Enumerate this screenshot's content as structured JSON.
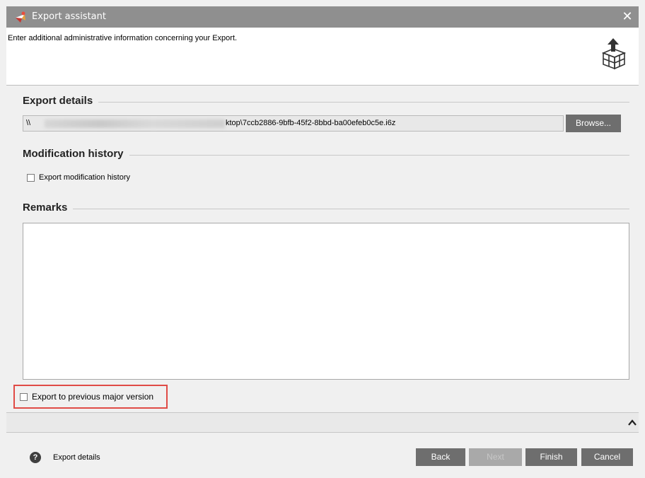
{
  "window": {
    "title": "Export assistant",
    "close_symbol": "✕"
  },
  "header": {
    "instruction": "Enter additional administrative information concerning your Export."
  },
  "export_details": {
    "title": "Export details",
    "path_prefix": "\\\\",
    "path_visible": "ktop\\7ccb2886-9bfb-45f2-8bbd-ba00efeb0c5e.i6z",
    "browse_label": "Browse..."
  },
  "modification_history": {
    "title": "Modification history",
    "checkbox_label": "Export modification history",
    "checked": false
  },
  "remarks": {
    "title": "Remarks",
    "value": ""
  },
  "previous_version": {
    "checkbox_label": "Export to previous major version",
    "checked": false
  },
  "footer": {
    "help_symbol": "?",
    "help_label": "Export details",
    "back_label": "Back",
    "next_label": "Next",
    "finish_label": "Finish",
    "cancel_label": "Cancel"
  },
  "icons": {
    "app": "app-logo-icon",
    "export_cube": "export-cube-icon",
    "collapse": "chevron-up-icon"
  }
}
